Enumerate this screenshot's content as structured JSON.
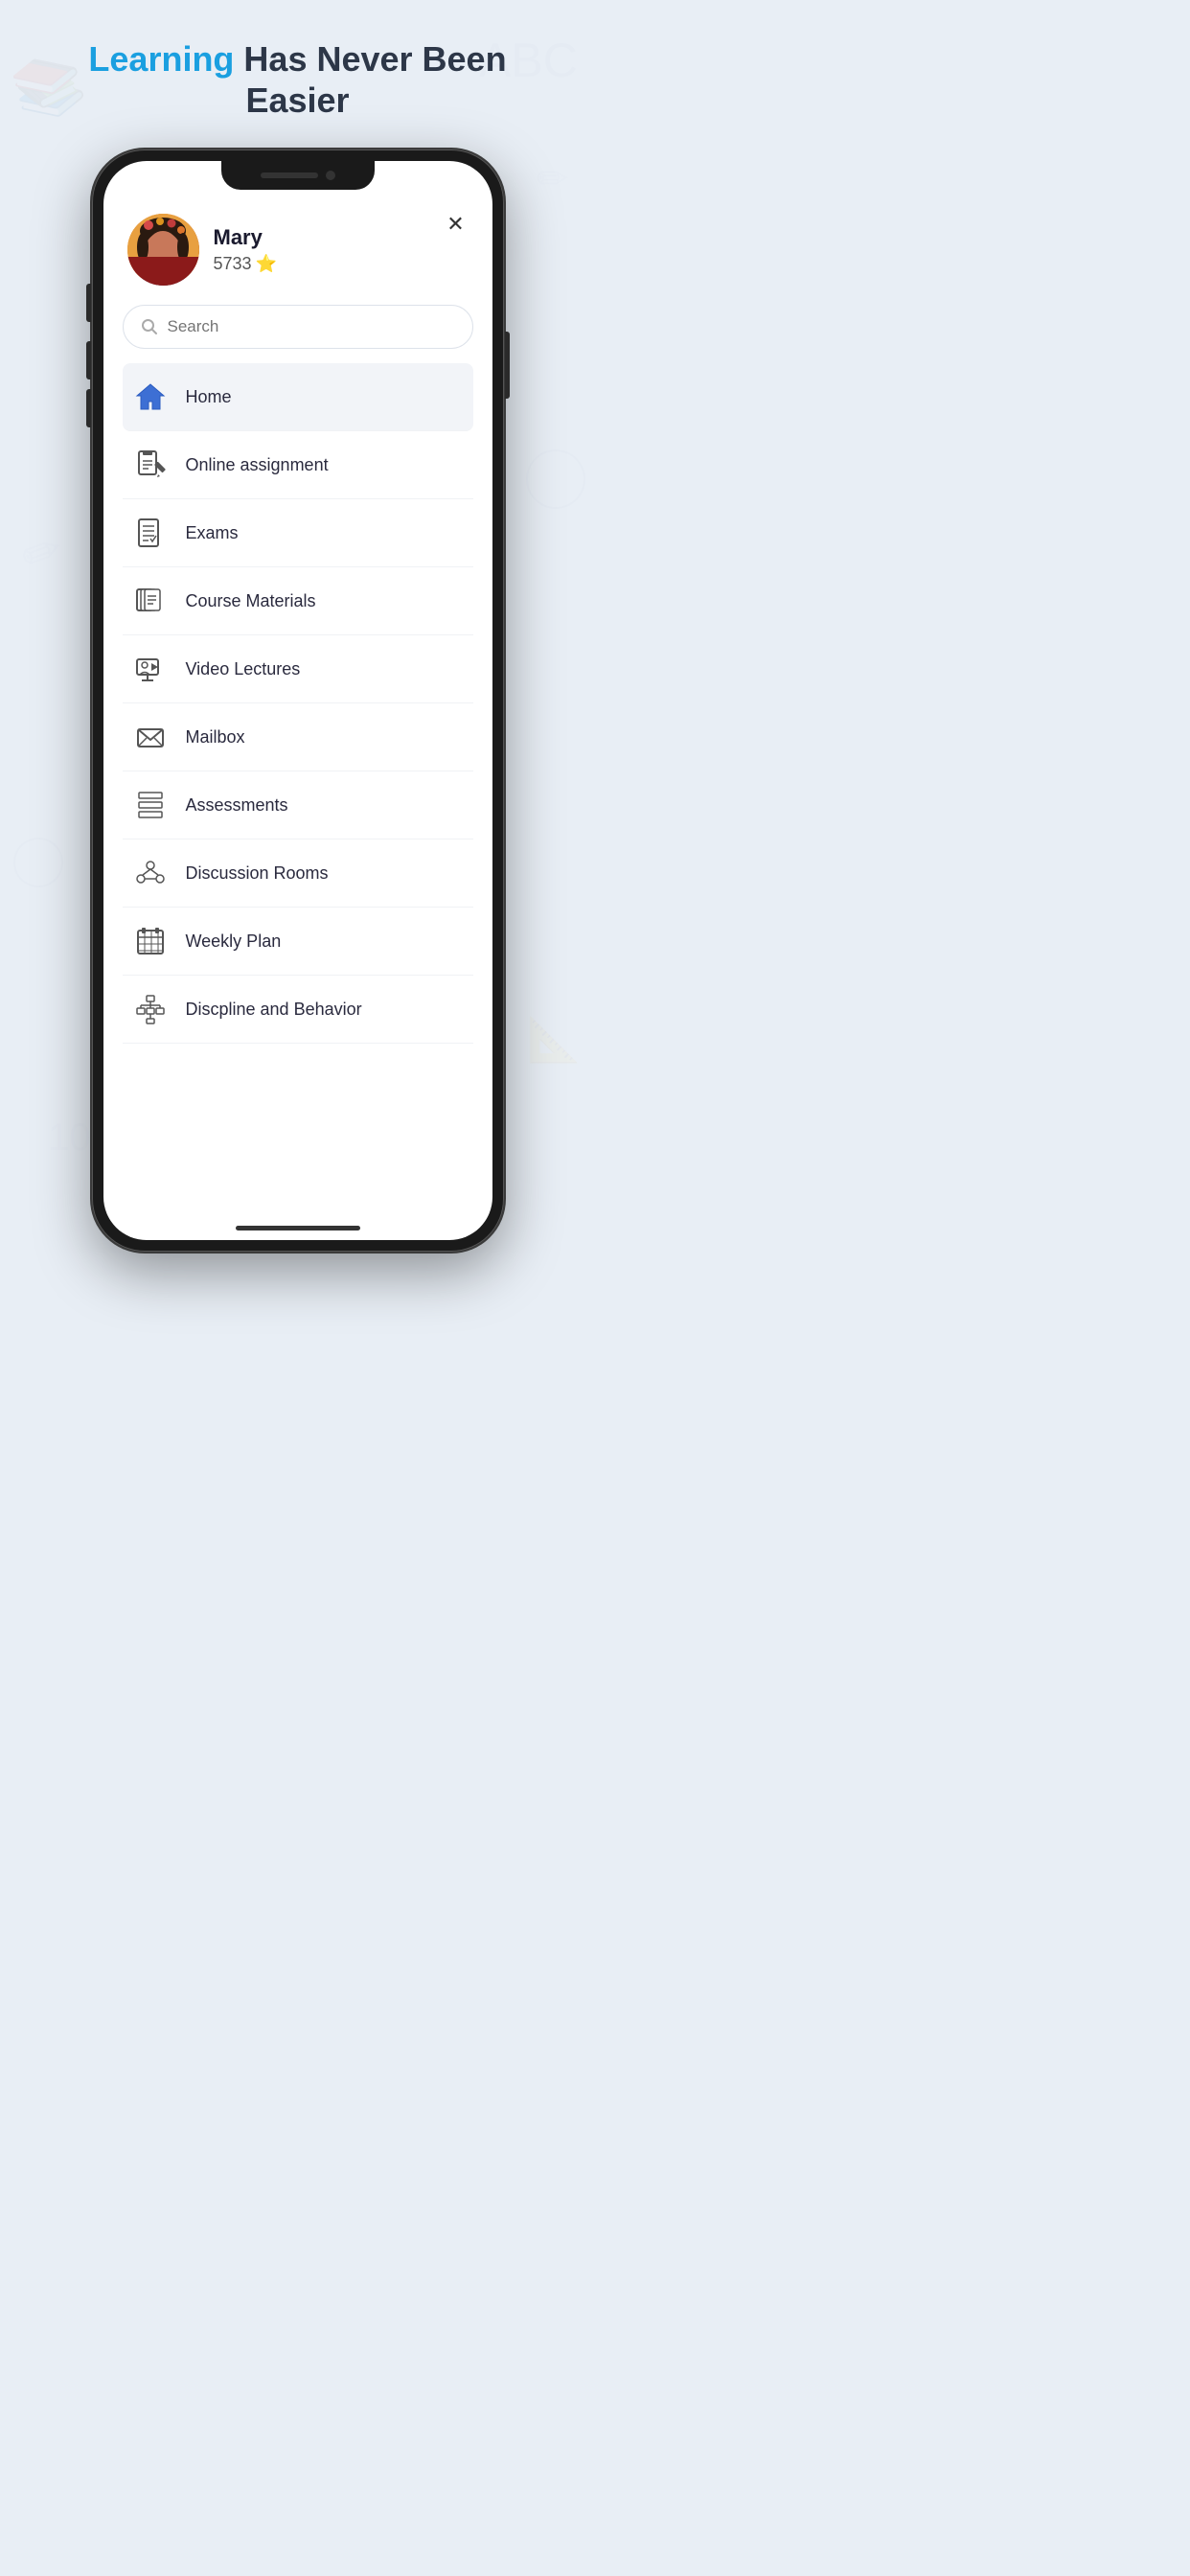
{
  "header": {
    "title_part1": "Learning",
    "title_part2": " Has Never Been Easier",
    "highlight_color": "#1a9fe0"
  },
  "close_button": "✕",
  "user": {
    "name": "Mary",
    "score": "5733",
    "score_icon": "⭐"
  },
  "search": {
    "placeholder": "Search"
  },
  "menu": {
    "items": [
      {
        "id": "home",
        "label": "Home",
        "active": true
      },
      {
        "id": "online-assignment",
        "label": "Online assignment",
        "active": false
      },
      {
        "id": "exams",
        "label": "Exams",
        "active": false
      },
      {
        "id": "course-materials",
        "label": "Course Materials",
        "active": false
      },
      {
        "id": "video-lectures",
        "label": "Video Lectures",
        "active": false
      },
      {
        "id": "mailbox",
        "label": "Mailbox",
        "active": false
      },
      {
        "id": "assessments",
        "label": "Assessments",
        "active": false
      },
      {
        "id": "discussion-rooms",
        "label": "Discussion Rooms",
        "active": false
      },
      {
        "id": "weekly-plan",
        "label": "Weekly Plan",
        "active": false
      },
      {
        "id": "discipline-behavior",
        "label": "Discpline and Behavior",
        "active": false
      }
    ]
  }
}
